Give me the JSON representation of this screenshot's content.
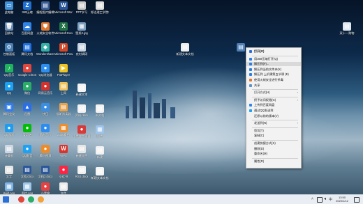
{
  "desktop": {
    "icons": [
      {
        "label": "此电脑",
        "glyph": "▭",
        "color": "#3d8fd6"
      },
      {
        "label": "360压缩",
        "glyph": "Z",
        "color": "#1e6fd0"
      },
      {
        "label": "编程图片编辑",
        "glyph": "▤",
        "color": "#3b5f99"
      },
      {
        "label": "Microsoft Word 2016",
        "glyph": "W",
        "color": "#2b579a"
      },
      {
        "label": "PPT学习",
        "glyph": "▤",
        "color": "#c9c9c9"
      },
      {
        "label": "郑达理工学院2019学期",
        "glyph": "▤",
        "color": "#dedede"
      },
      {
        "label": "回收站",
        "glyph": "🗑",
        "color": "#6b8db3"
      },
      {
        "label": "百度网盘",
        "glyph": "☁",
        "color": "#2e83e6"
      },
      {
        "label": "火绒安全软件",
        "glyph": "⛊",
        "color": "#e0792f"
      },
      {
        "label": "Microsoft Excel 2016",
        "glyph": "X",
        "color": "#217346"
      },
      {
        "label": "壁纸2.jpg",
        "glyph": "▦",
        "color": "#7d9fbf"
      },
      {
        "label": "控制面板",
        "glyph": "⚙",
        "color": "#4a7fb5"
      },
      {
        "label": "腾讯文档",
        "glyph": "▤",
        "color": "#1f6fe0"
      },
      {
        "label": "Wondershare Filmora",
        "glyph": "◆",
        "color": "#35b0a5"
      },
      {
        "label": "Microsoft PowerPoint",
        "glyph": "P",
        "color": "#d24726"
      },
      {
        "label": "农村调研",
        "glyph": "▤",
        "color": "#c7d3df"
      },
      {
        "label": "新建文本文档",
        "glyph": "▤",
        "color": "#eeeeee"
      },
      {
        "label": "QQ音乐",
        "glyph": "♪",
        "color": "#1fb35d"
      },
      {
        "label": "Google Chrome",
        "glyph": "●",
        "color": "#e2463c"
      },
      {
        "label": "QQ浏览器",
        "glyph": "●",
        "color": "#2d8ff0"
      },
      {
        "label": "PotPlayer",
        "glyph": "▶",
        "color": "#f0c420"
      },
      {
        "label": "QQ",
        "glyph": "●",
        "color": "#1da1f2"
      },
      {
        "label": "微信",
        "glyph": "●",
        "color": "#2aae67"
      },
      {
        "label": "网易云音乐",
        "glyph": "●",
        "color": "#d5312c"
      },
      {
        "label": "上网",
        "glyph": "▤",
        "color": "#f0c15a"
      },
      {
        "label": "腾讯会议",
        "glyph": "▣",
        "color": "#2f7df2"
      },
      {
        "label": "迅雷",
        "glyph": "▲",
        "color": "#2a6fe8"
      },
      {
        "label": "快压",
        "glyph": "●",
        "color": "#3b8ee2"
      },
      {
        "label": "福昕阅读器",
        "glyph": "▤",
        "color": "#e8a24a"
      },
      {
        "label": "QQ游戏",
        "glyph": "●",
        "color": "#1e9cf0"
      },
      {
        "label": "爱奇艺",
        "glyph": "●",
        "color": "#00be06"
      },
      {
        "label": "酷狗音乐",
        "glyph": "●",
        "color": "#2e8cf0"
      },
      {
        "label": "2345看图",
        "glyph": "▦",
        "color": "#ee8d2a"
      },
      {
        "label": "计算机",
        "glyph": "▤",
        "color": "#cfd8e2"
      },
      {
        "label": "QQ影音",
        "glyph": "●",
        "color": "#1da1f2"
      },
      {
        "label": "腾讯视频",
        "glyph": "●",
        "color": "#f08a24"
      },
      {
        "label": "WPS",
        "glyph": "W",
        "color": "#d9332b"
      },
      {
        "label": "新建文件",
        "glyph": "▤",
        "color": "#e6e6e6"
      },
      {
        "label": "文字",
        "glyph": "▤",
        "color": "#e6e6e6"
      },
      {
        "label": "文档.docx",
        "glyph": "▤",
        "color": "#2b579a"
      },
      {
        "label": "文档2.docx",
        "glyph": "▤",
        "color": "#2b579a"
      },
      {
        "label": "小红书",
        "glyph": "●",
        "color": "#ff2442"
      },
      {
        "label": "RSS.docx",
        "glyph": "▤",
        "color": "#f0f0f0"
      },
      {
        "label": "新建.png",
        "glyph": "▦",
        "color": "#7db3e6"
      },
      {
        "label": "图片.png",
        "glyph": "▦",
        "color": "#9ec5e8"
      },
      {
        "label": "小黑盒",
        "glyph": "●",
        "color": "#e84141"
      },
      {
        "label": "文件",
        "glyph": "▤",
        "color": "#e9e9e9"
      },
      {
        "label": "新建文本",
        "glyph": "▤",
        "color": "#f2f2f2"
      },
      {
        "label": "资料.docx",
        "glyph": "▤",
        "color": "#f2f2f2"
      },
      {
        "label": "小黑盒加速器",
        "glyph": "●",
        "color": "#d83a3a"
      },
      {
        "label": "新文档",
        "glyph": "▤",
        "color": "#f2f2f2"
      },
      {
        "label": "照片",
        "glyph": "▦",
        "color": "#9cc3ea"
      },
      {
        "label": "新建",
        "glyph": "▤",
        "color": "#f2f2f2"
      },
      {
        "label": "新建文本文档",
        "glyph": "▤",
        "color": "#f5f5f5"
      },
      {
        "label": "",
        "glyph": "▤",
        "color": "#4e7fb6"
      },
      {
        "label": "双十一购物",
        "glyph": "▤",
        "color": "#dfe7ef"
      }
    ]
  },
  "context_menu": {
    "items": [
      {
        "label": "打开(O)",
        "icon_color": "#2b6fd6",
        "bold": true
      },
      {
        "label": "用360压缩打开(Q)",
        "icon_color": "#2a7de1"
      },
      {
        "label": "解压到(F)...",
        "icon_color": "#2a7de1",
        "highlight": true
      },
      {
        "label": "解压到当前文件夹(X)",
        "icon_color": "#2a7de1"
      },
      {
        "label": "解压到 上机课第五节课 (E)",
        "icon_color": "#2a7de1"
      },
      {
        "label": "使用火绒安全进行杀毒",
        "icon_color": "#e0792f"
      },
      {
        "label": "共享",
        "icon_color": "#5b8fc8"
      },
      {
        "label": "打开方式(H)",
        "icon_color": "",
        "arrow": true
      },
      {
        "label": "授予访问权限(G)",
        "icon_color": "",
        "arrow": true
      },
      {
        "label": "上传到百度网盘",
        "icon_color": "#2e83e6"
      },
      {
        "label": "通过QQ发送到",
        "icon_color": "#1da1f2"
      },
      {
        "label": "还原以前的版本(V)",
        "icon_color": ""
      },
      {
        "label": "发送到(N)",
        "icon_color": "",
        "arrow": true
      },
      {
        "label": "剪切(T)",
        "icon_color": ""
      },
      {
        "label": "复制(C)",
        "icon_color": ""
      },
      {
        "label": "创建快捷方式(S)",
        "icon_color": ""
      },
      {
        "label": "删除(D)",
        "icon_color": ""
      },
      {
        "label": "重命名(M)",
        "icon_color": ""
      },
      {
        "label": "属性(R)",
        "icon_color": ""
      }
    ]
  },
  "taskbar": {
    "apps": [
      {
        "name": "windows-start-icon",
        "color": "#2a6fd6"
      },
      {
        "name": "chrome-icon",
        "color": "#e0473a"
      },
      {
        "name": "wechat-icon",
        "color": "#2aae67"
      },
      {
        "name": "qq-browser-icon",
        "color": "#f2a23a"
      }
    ],
    "tray": {
      "time": "13:50",
      "date": "2020/1/12"
    }
  }
}
